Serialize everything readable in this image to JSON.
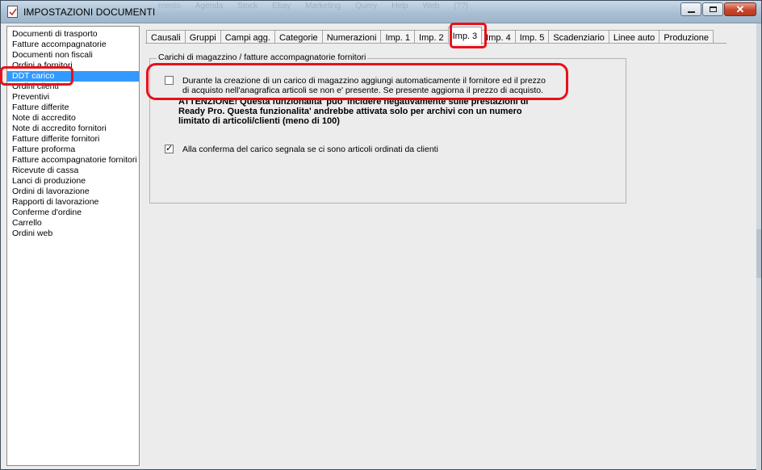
{
  "window": {
    "title": "IMPOSTAZIONI DOCUMENTI",
    "background_menu": [
      "mento",
      "Agenda",
      "Stock",
      "Ebay",
      "Marketing",
      "Query",
      "Help",
      "Web",
      "(??)"
    ]
  },
  "sidebar": {
    "items": [
      "Documenti di trasporto",
      "Fatture accompagnatorie",
      "Documenti non fiscali",
      "Ordini a fornitori",
      "DDT carico",
      "Ordini clienti",
      "Preventivi",
      "Fatture differite",
      "Note di accredito",
      "Note di accredito fornitori",
      "Fatture differite fornitori",
      "Fatture proforma",
      "Fatture accompagnatorie fornitori",
      "Ricevute di cassa",
      "Lanci di produzione",
      "Ordini di lavorazione",
      "Rapporti di lavorazione",
      "Conferme d'ordine",
      "Carrello",
      "Ordini web"
    ],
    "selected": "DDT carico"
  },
  "tabs": [
    "Causali",
    "Gruppi",
    "Campi agg.",
    "Categorie",
    "Numerazioni",
    "Imp. 1",
    "Imp. 2",
    "Imp. 3",
    "Imp. 4",
    "Imp. 5",
    "Scadenziario",
    "Linee auto",
    "Produzione"
  ],
  "active_tab": "Imp. 3",
  "group": {
    "title": "Carichi di magazzino / fatture accompagnatorie fornitori",
    "option1": {
      "checked": false,
      "line1": "Durante la creazione di un carico di magazzino aggiungi automaticamente il fornitore ed il prezzo",
      "line2": "di acquisto nell'anagrafica articoli se non e' presente. Se presente aggiorna il prezzo di acquisto."
    },
    "warning": {
      "line1": "ATTENZIONE! Questa funzionalita' puo' incidere negativamente sulle prestazioni di",
      "line2": "Ready Pro. Questa funzionalita' andrebbe attivata solo per archivi con un numero",
      "line3": "limitato di articoli/clienti (meno di 100)"
    },
    "option2": {
      "checked": true,
      "label": "Alla conferma del carico segnala se ci sono articoli ordinati da clienti"
    }
  },
  "colors": {
    "annotation_red": "#e8101a",
    "selection_blue": "#3399ff"
  }
}
